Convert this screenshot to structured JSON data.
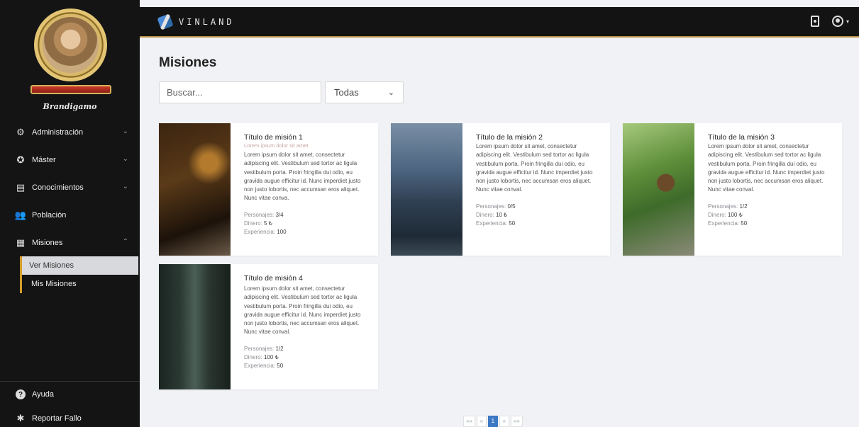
{
  "profile": {
    "name": "Brandigamo"
  },
  "sidebar": {
    "items": [
      {
        "label": "Administración",
        "icon": "users-cog-icon",
        "glyph": "⚙",
        "chevron": "⌄"
      },
      {
        "label": "Máster",
        "icon": "master-icon",
        "glyph": "✪",
        "chevron": "⌄"
      },
      {
        "label": "Conocimientos",
        "icon": "book-icon",
        "glyph": "▤",
        "chevron": "⌄"
      },
      {
        "label": "Población",
        "icon": "people-icon",
        "glyph": "👥",
        "chevron": ""
      },
      {
        "label": "Misiones",
        "icon": "missions-icon",
        "glyph": "▦",
        "chevron": "⌃"
      }
    ],
    "subitems": [
      {
        "label": "Ver Misiones",
        "active": true
      },
      {
        "label": "Mis Misiones",
        "active": false
      }
    ],
    "footer": [
      {
        "label": "Ayuda",
        "icon": "help-icon",
        "glyph": "?"
      },
      {
        "label": "Reportar Fallo",
        "icon": "bug-icon",
        "glyph": "✱"
      }
    ]
  },
  "topbar": {
    "brand": "VINLAND"
  },
  "main": {
    "title": "Misiones",
    "search_placeholder": "Buscar...",
    "filter_value": "Todas",
    "missions": [
      {
        "title": "Título de misión 1",
        "subtitle": "Lorem ipsum dolor sit amet",
        "description": "Lorem ipsum dolor sit amet, consectetur adipiscing elit. Vestibulum sed tortor ac ligula vestibulum porta. Proin fringilla dui odio, eu gravida augue efficitur id. Nunc imperdiet justo non justo lobortis, nec accumsan eros aliquet. Nunc vitae conva.",
        "characters_label": "Personajes:",
        "characters": "3/4",
        "money_label": "Dinero:",
        "money": "5 ₺",
        "experience_label": "Experiencia:",
        "experience": "100"
      },
      {
        "title": "Título de la misión 2",
        "subtitle": "",
        "description": "Lorem ipsum dolor sit amet, consectetur adipiscing elit. Vestibulum sed tortor ac ligula vestibulum porta. Proin fringilla dui odio, eu gravida augue efficitur id. Nunc imperdiet justo non justo lobortis, nec accumsan eros aliquet. Nunc vitae conval.",
        "characters_label": "Personajes:",
        "characters": "0/5",
        "money_label": "Dinero:",
        "money": "10 ₺",
        "experience_label": "Experiencia:",
        "experience": "50"
      },
      {
        "title": "Título de la misión 3",
        "subtitle": "",
        "description": "Lorem ipsum dolor sit amet, consectetur adipiscing elit. Vestibulum sed tortor ac ligula vestibulum porta. Proin fringilla dui odio, eu gravida augue efficitur id. Nunc imperdiet justo non justo lobortis, nec accumsan eros aliquet. Nunc vitae conval.",
        "characters_label": "Personajes:",
        "characters": "1/2",
        "money_label": "Dinero:",
        "money": "100 ₺",
        "experience_label": "Experiencia:",
        "experience": "50"
      },
      {
        "title": "Título de misión 4",
        "subtitle": "",
        "description": "Lorem ipsum dolor sit amet, consectetur adipiscing elit. Vestibulum sed tortor ac ligula vestibulum porta. Proin fringilla dui odio, eu gravida augue efficitur id. Nunc imperdiet justo non justo lobortis, nec accumsan eros aliquet. Nunc vitae conval.",
        "characters_label": "Personajes:",
        "characters": "1/2",
        "money_label": "Dinero:",
        "money": "100 ₺",
        "experience_label": "Experiencia:",
        "experience": "50"
      }
    ]
  },
  "pagination": {
    "first": "««",
    "prev": "«",
    "current": "1",
    "next": "»",
    "last": "»»"
  }
}
